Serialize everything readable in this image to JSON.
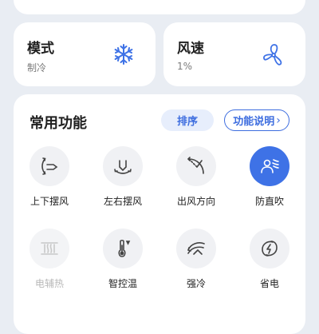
{
  "tiles": {
    "mode": {
      "title": "模式",
      "value": "制冷",
      "icon": "snowflake-icon"
    },
    "wind": {
      "title": "风速",
      "value": "1%",
      "icon": "fan-icon"
    }
  },
  "functions": {
    "title": "常用功能",
    "sort_label": "排序",
    "help_label": "功能说明",
    "items": [
      {
        "label": "上下摆风",
        "icon": "vertical-swing-icon",
        "active": false,
        "disabled": false
      },
      {
        "label": "左右摆风",
        "icon": "horizontal-swing-icon",
        "active": false,
        "disabled": false
      },
      {
        "label": "出风方向",
        "icon": "air-direction-icon",
        "active": false,
        "disabled": false
      },
      {
        "label": "防直吹",
        "icon": "anti-direct-blow-icon",
        "active": true,
        "disabled": false
      },
      {
        "label": "电辅热",
        "icon": "electric-heating-icon",
        "active": false,
        "disabled": true
      },
      {
        "label": "智控温",
        "icon": "thermometer-icon",
        "active": false,
        "disabled": false
      },
      {
        "label": "强冷",
        "icon": "strong-cooling-icon",
        "active": false,
        "disabled": false
      },
      {
        "label": "省电",
        "icon": "power-saving-icon",
        "active": false,
        "disabled": false
      }
    ]
  },
  "colors": {
    "accent": "#3e72e6",
    "background": "#e9edf3",
    "card": "#ffffff",
    "icon_circle": "#f0f1f4"
  }
}
